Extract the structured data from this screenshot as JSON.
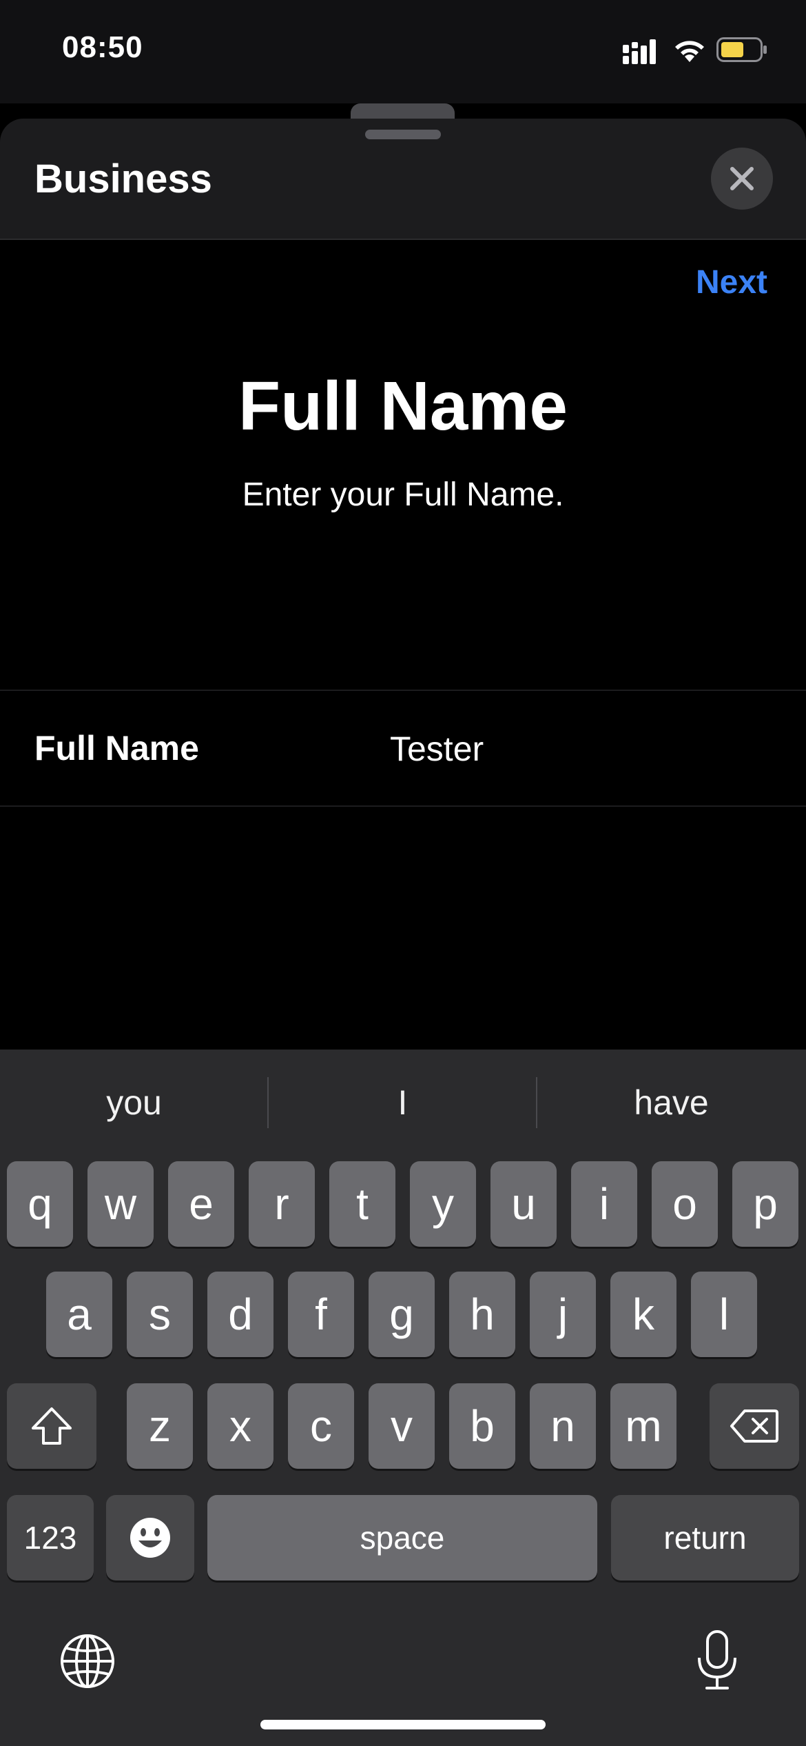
{
  "status_bar": {
    "time": "08:50"
  },
  "sheet": {
    "title": "Business",
    "next_label": "Next"
  },
  "page": {
    "title": "Full Name",
    "subtitle": "Enter your Full Name."
  },
  "field": {
    "label": "Full Name",
    "value": "Tester"
  },
  "keyboard": {
    "suggestions": [
      "you",
      "I",
      "have"
    ],
    "row1": [
      "q",
      "w",
      "e",
      "r",
      "t",
      "y",
      "u",
      "i",
      "o",
      "p"
    ],
    "row2": [
      "a",
      "s",
      "d",
      "f",
      "g",
      "h",
      "j",
      "k",
      "l"
    ],
    "row3": [
      "z",
      "x",
      "c",
      "v",
      "b",
      "n",
      "m"
    ],
    "numbers_label": "123",
    "space_label": "space",
    "return_label": "return"
  },
  "colors": {
    "accent": "#3b82f6",
    "battery": "#f5d34a"
  },
  "icons": [
    "signal-icon",
    "wifi-icon",
    "battery-icon",
    "close-icon",
    "shift-icon",
    "backspace-icon",
    "emoji-icon",
    "globe-icon",
    "microphone-icon"
  ]
}
